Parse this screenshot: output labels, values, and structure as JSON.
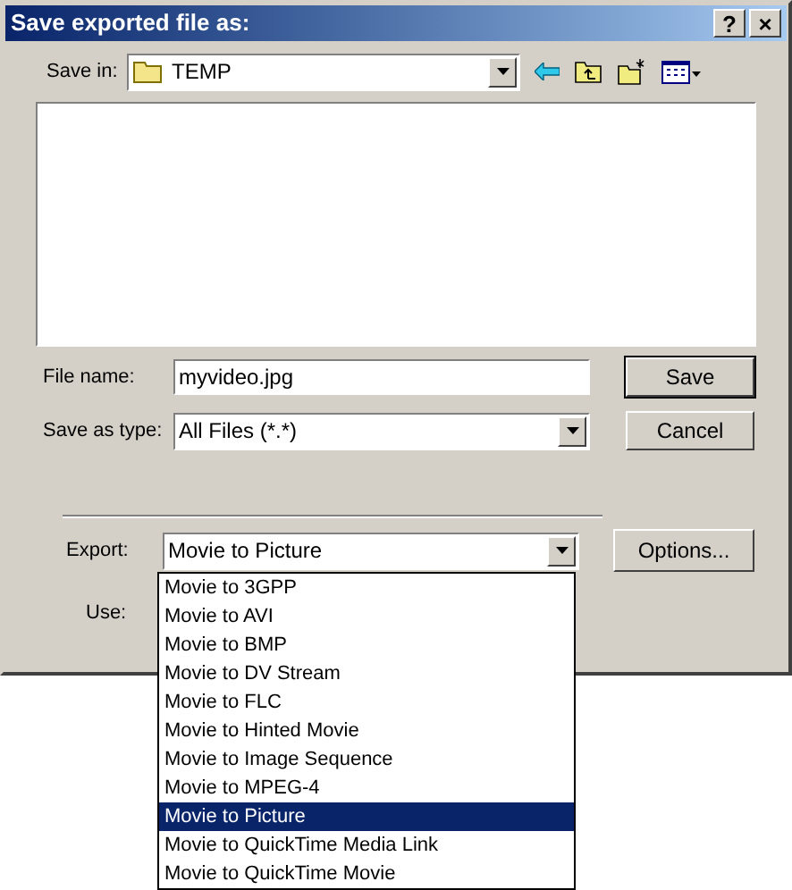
{
  "window": {
    "title": "Save exported file as:",
    "title_buttons": [
      "?",
      "×"
    ]
  },
  "save_in": {
    "label": "Save in:",
    "value": "TEMP"
  },
  "file_name": {
    "label": "File name:",
    "value": "myvideo.jpg"
  },
  "save_as_type": {
    "label": "Save as type:",
    "value": "All Files (*.*)"
  },
  "buttons": [
    "Save",
    "Cancel"
  ],
  "export": {
    "label": "Export:",
    "value": "Movie to Picture",
    "button": "Options...",
    "options": [
      {
        "label": "Movie to 3GPP",
        "selected": false
      },
      {
        "label": "Movie to AVI",
        "selected": false
      },
      {
        "label": "Movie to BMP",
        "selected": false
      },
      {
        "label": "Movie to DV Stream",
        "selected": false
      },
      {
        "label": "Movie to FLC",
        "selected": false
      },
      {
        "label": "Movie to Hinted Movie",
        "selected": false
      },
      {
        "label": "Movie to Image Sequence",
        "selected": false
      },
      {
        "label": "Movie to MPEG-4",
        "selected": false
      },
      {
        "label": "Movie to Picture",
        "selected": true
      },
      {
        "label": "Movie to QuickTime Media Link",
        "selected": false
      },
      {
        "label": "Movie to QuickTime Movie",
        "selected": false
      }
    ]
  },
  "use": {
    "label": "Use:"
  }
}
